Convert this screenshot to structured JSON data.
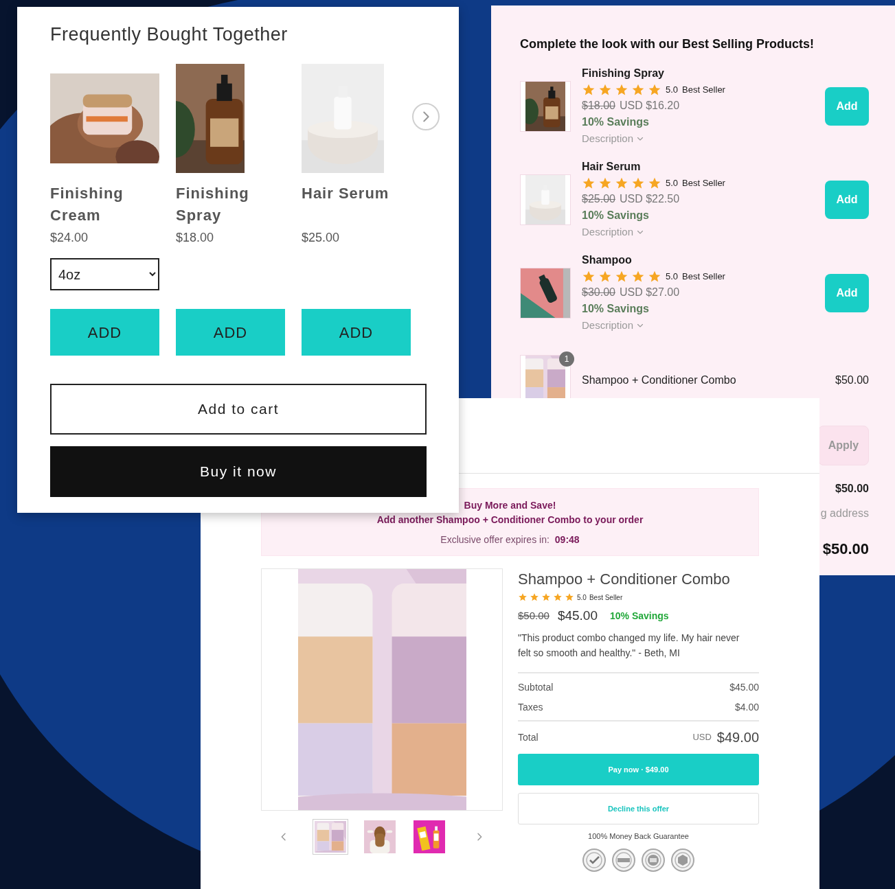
{
  "frequently_bought": {
    "title": "Frequently Bought Together",
    "products": [
      {
        "name": "Finishing Cream",
        "price": "$24.00",
        "variant": "4oz",
        "button": "ADD"
      },
      {
        "name": "Finishing Spray",
        "price": "$18.00",
        "button": "ADD"
      },
      {
        "name": "Hair Serum",
        "price": "$25.00",
        "button": "ADD"
      }
    ],
    "add_to_cart": "Add to cart",
    "buy_now": "Buy it now"
  },
  "best_sellers": {
    "title": "Complete the look with our Best Selling Products!",
    "items": [
      {
        "name": "Finishing Spray",
        "stars": 5,
        "rating": "5.0",
        "badge": "Best Seller",
        "old_price": "$18.00",
        "price": "USD $16.20",
        "savings": "10% Savings",
        "description": "Description",
        "button": "Add"
      },
      {
        "name": "Hair Serum",
        "stars": 5,
        "rating": "5.0",
        "badge": "Best Seller",
        "old_price": "$25.00",
        "price": "USD $22.50",
        "savings": "10% Savings",
        "description": "Description",
        "button": "Add"
      },
      {
        "name": "Shampoo",
        "stars": 5,
        "rating": "5.0",
        "badge": "Best Seller",
        "old_price": "$30.00",
        "price": "USD $27.00",
        "savings": "10% Savings",
        "description": "Description",
        "button": "Add"
      }
    ],
    "cart_item": {
      "name": "Shampoo + Conditioner Combo",
      "price": "$50.00",
      "quantity": "1"
    },
    "discount_button": "Apply",
    "subtotal": "$50.00",
    "shipping_note": "g address",
    "total": "$50.00"
  },
  "upsell": {
    "banner": {
      "title": "Buy More and Save!",
      "subtitle": "Add another Shampoo + Conditioner Combo to your order",
      "timer_label": "Exclusive offer expires in:",
      "timer": "09:48"
    },
    "product": {
      "name": "Shampoo + Conditioner Combo",
      "stars": 5,
      "rating": "5.0",
      "badge": "Best Seller",
      "old_price": "$50.00",
      "price": "$45.00",
      "savings": "10% Savings",
      "quote": "\"This product combo changed my life. My hair never felt so smooth and healthy.\" - Beth, MI"
    },
    "thumbnails": [
      {
        "selected": true
      },
      {
        "selected": false
      },
      {
        "selected": false
      }
    ],
    "summary": [
      {
        "label": "Subtotal",
        "value": "$45.00"
      },
      {
        "label": "Taxes",
        "value": "$4.00"
      }
    ],
    "total": {
      "label": "Total",
      "currency": "USD",
      "value": "$49.00"
    },
    "pay_button": "Pay now · $49.00",
    "decline_button": "Decline this offer",
    "guarantee": "100% Money Back Guarantee"
  }
}
